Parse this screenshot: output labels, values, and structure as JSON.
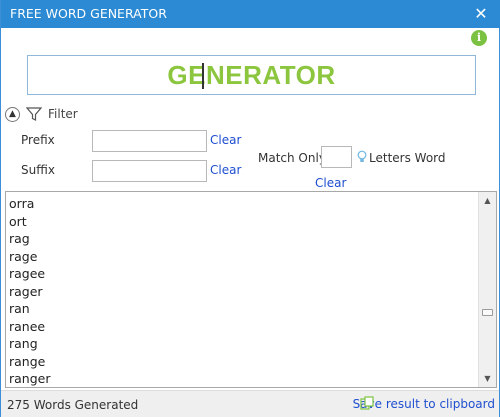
{
  "window": {
    "title": "FREE WORD GENERATOR",
    "close_glyph": "✕"
  },
  "icons": {
    "close": "close-icon",
    "info": "info-icon",
    "collapse": "chevron-up-icon",
    "filter": "filter-icon",
    "bulb": "lightbulb-icon",
    "clipboard": "clipboard-icon"
  },
  "colors": {
    "titlebar": "#2b8ad3",
    "generator_text": "#8cc63f",
    "link": "#1f4fd0",
    "info": "#7cc242"
  },
  "generator": {
    "value": "GENERATOR"
  },
  "filter": {
    "label": "Filter",
    "prefix_label": "Prefix",
    "prefix_value": "",
    "prefix_clear": "Clear",
    "suffix_label": "Suffix",
    "suffix_value": "",
    "suffix_clear": "Clear",
    "match_only_label": "Match Only",
    "match_only_value": "",
    "letters_word_label": "Letters Word",
    "match_clear": "Clear"
  },
  "results": {
    "items": [
      "orra",
      "ort",
      "rag",
      "rage",
      "ragee",
      "rager",
      "ran",
      "ranee",
      "rang",
      "range",
      "ranger"
    ]
  },
  "status": {
    "count_text": "275 Words Generated",
    "save_label": "Save result to clipboard"
  }
}
